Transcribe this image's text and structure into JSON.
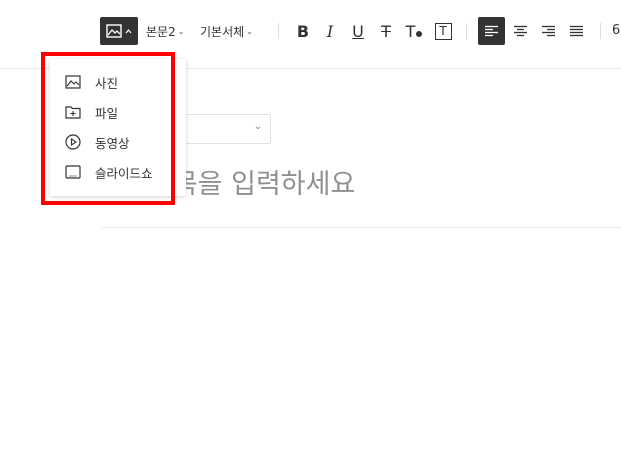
{
  "toolbar": {
    "paragraph_style": "본문2",
    "font_family": "기본서체",
    "truncated_value": "6",
    "icons": [
      "image-icon",
      "bold-icon",
      "italic-icon",
      "underline-icon",
      "strikethrough-icon",
      "text-color-icon",
      "text-background-icon",
      "align-left-icon",
      "align-center-icon",
      "align-right-icon",
      "align-justify-icon"
    ],
    "text_glyphs": {
      "bold": "B",
      "italic": "I",
      "underline": "U",
      "strike": "T",
      "color": "T",
      "background": "T"
    }
  },
  "insert_menu": {
    "items": [
      {
        "label": "사진",
        "icon": "photo-icon"
      },
      {
        "label": "파일",
        "icon": "file-add-icon"
      },
      {
        "label": "동영상",
        "icon": "video-play-icon"
      },
      {
        "label": "슬라이드쇼",
        "icon": "slideshow-icon"
      }
    ]
  },
  "editor": {
    "title_placeholder": "제목을 입력하세요"
  },
  "colors": {
    "highlight": "#ff0000",
    "active_button": "#333333"
  }
}
